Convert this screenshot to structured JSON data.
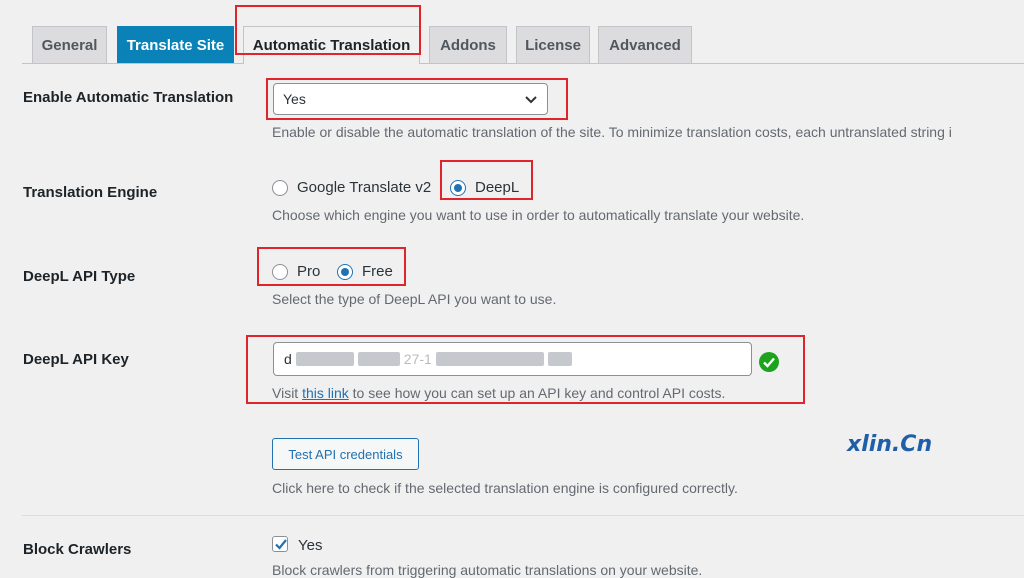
{
  "tabs": [
    {
      "label": "General"
    },
    {
      "label": "Translate Site"
    },
    {
      "label": "Automatic Translation"
    },
    {
      "label": "Addons"
    },
    {
      "label": "License"
    },
    {
      "label": "Advanced"
    }
  ],
  "auto_translation": {
    "label": "Enable Automatic Translation",
    "value": "Yes",
    "description": "Enable or disable the automatic translation of the site. To minimize translation costs, each untranslated string i"
  },
  "engine": {
    "label": "Translation Engine",
    "options": [
      "Google Translate v2",
      "DeepL"
    ],
    "selected": "DeepL",
    "description": "Choose which engine you want to use in order to automatically translate your website."
  },
  "api_type": {
    "label": "DeepL API Type",
    "options": [
      "Pro",
      "Free"
    ],
    "selected": "Free",
    "description": "Select the type of DeepL API you want to use."
  },
  "api_key": {
    "label": "DeepL API Key",
    "visible_prefix": "d",
    "visible_fragment": "27-1",
    "hint_before": "Visit ",
    "hint_link": "this link",
    "hint_after": " to see how you can set up an API key and control API costs."
  },
  "test": {
    "button": "Test API credentials",
    "description": "Click here to check if the selected translation engine is configured correctly."
  },
  "crawlers": {
    "label": "Block Crawlers",
    "checkbox_label": "Yes",
    "description": "Block crawlers from triggering automatic translations on your website."
  },
  "watermark": "xlin.Cn",
  "colors": {
    "accent": "#2271b1",
    "active_tab": "#0a82b8",
    "highlight": "#e0242b",
    "success": "#1ea31e"
  }
}
